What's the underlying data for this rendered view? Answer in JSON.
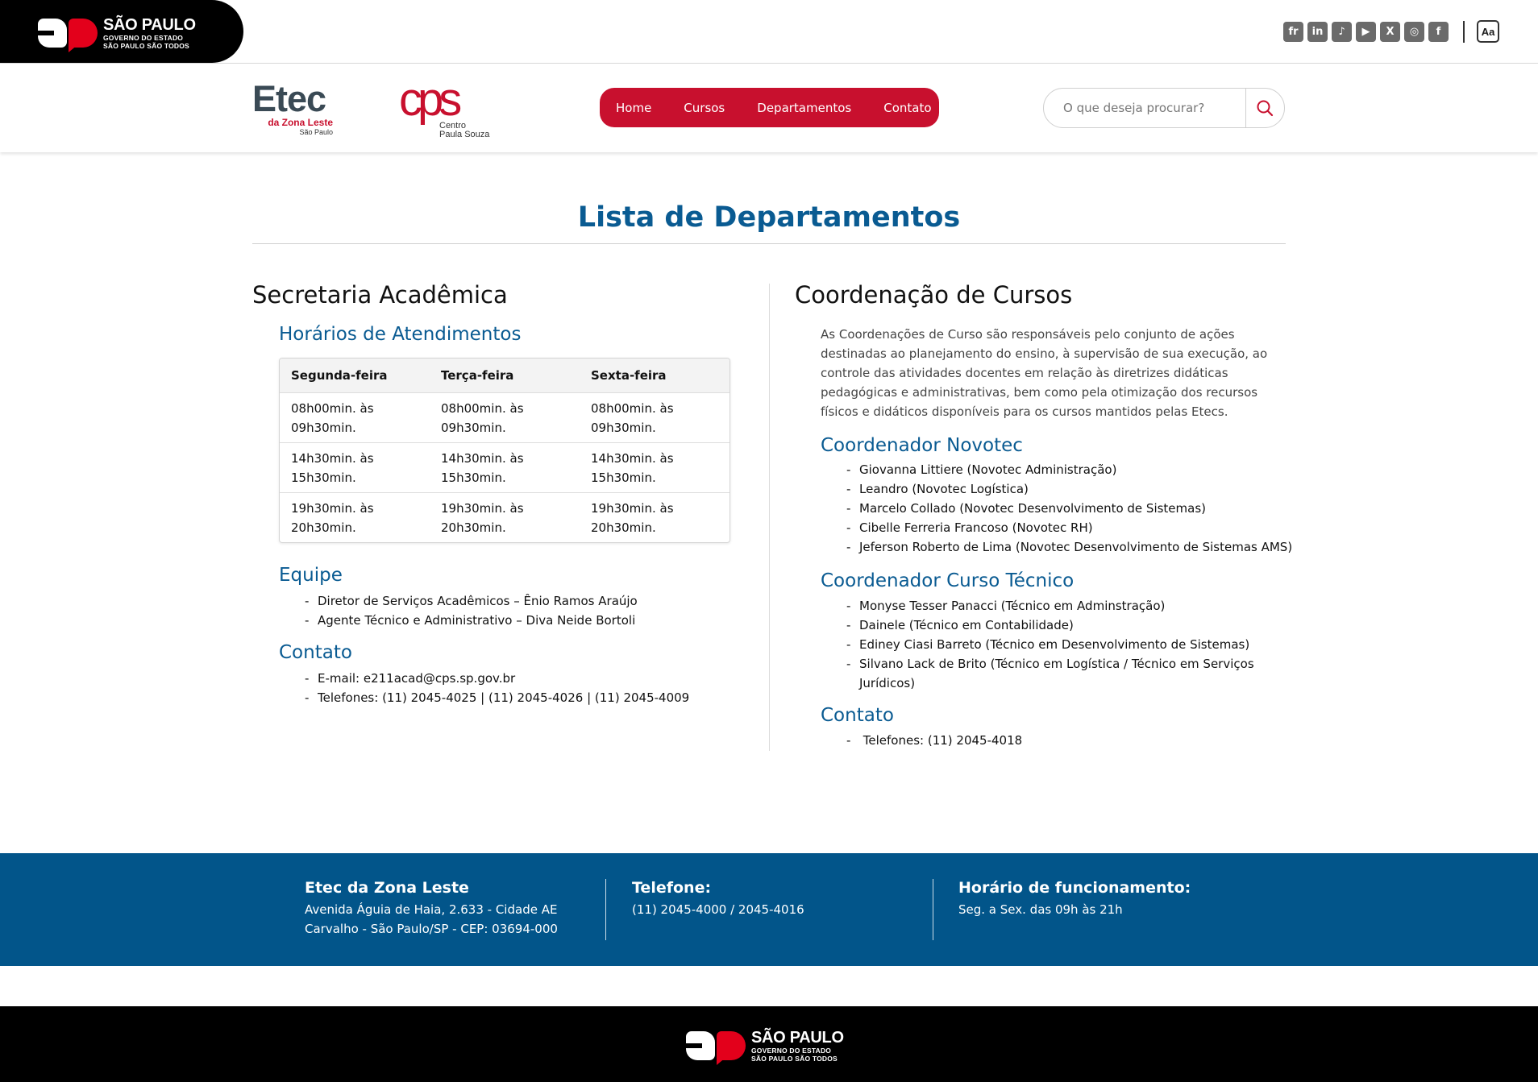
{
  "gov_bar": {
    "logo": {
      "line1": "SÃO PAULO",
      "line2": "GOVERNO DO ESTADO",
      "line3": "SÃO PAULO SÃO TODOS"
    },
    "social_icons": [
      {
        "icon": "flickr-icon",
        "glyph": "fr"
      },
      {
        "icon": "linkedin-icon",
        "glyph": "in"
      },
      {
        "icon": "tiktok-icon",
        "glyph": "♪"
      },
      {
        "icon": "youtube-icon",
        "glyph": "▶"
      },
      {
        "icon": "x-twitter-icon",
        "glyph": "X"
      },
      {
        "icon": "instagram-icon",
        "glyph": "◎"
      },
      {
        "icon": "facebook-icon",
        "glyph": "f"
      }
    ],
    "accessibility_label": "Aa"
  },
  "header": {
    "etec_logo": {
      "name": "Etec",
      "sub": "da Zona Leste",
      "city": "São Paulo"
    },
    "cps_logo": {
      "mark": "cps",
      "line1": "Centro",
      "line2": "Paula Souza"
    },
    "nav": [
      "Home",
      "Cursos",
      "Departamentos",
      "Contato"
    ],
    "search": {
      "placeholder": "O que deseja procurar?"
    }
  },
  "main": {
    "title": "Lista de Departamentos",
    "secretaria": {
      "heading": "Secretaria Acadêmica",
      "schedule_heading": "Horários de Atendimentos",
      "schedule": {
        "headers": [
          "Segunda-feira",
          "Terça-feira",
          "Sexta-feira"
        ],
        "rows": [
          [
            [
              "08h00min. às",
              "09h30min."
            ],
            [
              "08h00min. às",
              "09h30min."
            ],
            [
              "08h00min. às",
              "09h30min."
            ]
          ],
          [
            [
              "14h30min. às",
              "15h30min."
            ],
            [
              "14h30min. às",
              "15h30min."
            ],
            [
              "14h30min. às",
              "15h30min."
            ]
          ],
          [
            [
              "19h30min. às",
              "20h30min."
            ],
            [
              "19h30min. às",
              "20h30min."
            ],
            [
              "19h30min. às",
              "20h30min."
            ]
          ]
        ]
      },
      "team_heading": "Equipe",
      "team": [
        "Diretor de Serviços Acadêmicos – Ênio Ramos Araújo",
        "Agente Técnico e Administrativo – Diva Neide Bortoli"
      ],
      "contact_heading": "Contato",
      "contact": [
        "E-mail: e211acad@cps.sp.gov.br",
        "Telefones: (11) 2045-4025 | (11) 2045-4026 | (11) 2045-4009"
      ]
    },
    "coordenacao": {
      "heading": "Coordenação de Cursos",
      "description": "As Coordenações de Curso são responsáveis pelo conjunto de ações destinadas ao planejamento do ensino, à supervisão de sua execução, ao controle das atividades docentes em relação às diretrizes didáticas pedagógicas e administrativas, bem como pela otimização dos recursos físicos e didáticos disponíveis para os cursos mantidos pelas Etecs.",
      "novotec_heading": "Coordenador Novotec",
      "novotec": [
        "Giovanna Littiere (Novotec Administração)",
        "Leandro (Novotec Logística)",
        "Marcelo Collado (Novotec Desenvolvimento de Sistemas)",
        "Cibelle Ferreria Francoso (Novotec RH)",
        "Jeferson Roberto de Lima (Novotec Desenvolvimento de Sistemas AMS)"
      ],
      "tecnico_heading": "Coordenador Curso Técnico",
      "tecnico": [
        "Monyse Tesser Panacci (Técnico em Adminstração)",
        "Dainele (Técnico em Contabilidade)",
        "Ediney Ciasi Barreto (Técnico em Desenvolvimento de Sistemas)",
        "Silvano Lack de Brito (Técnico em Logística / Técnico em Serviços Jurídicos)"
      ],
      "contact_heading": "Contato",
      "contact": [
        " Telefones: (11) 2045-4018"
      ]
    }
  },
  "footer": {
    "address": {
      "title": "Etec da Zona Leste",
      "line1": "Avenida Águia de Haia, 2.633 - Cidade AE",
      "line2": "Carvalho - São Paulo/SP - CEP: 03694-000"
    },
    "phone": {
      "title": "Telefone:",
      "line1": "(11) 2045-4000 / 2045-4016"
    },
    "hours": {
      "title": "Horário de funcionamento:",
      "line1": "Seg. a Sex. das 09h às 21h"
    },
    "gov_logo": {
      "line1": "SÃO PAULO",
      "line2": "GOVERNO DO ESTADO",
      "line3": "SÃO PAULO SÃO TODOS"
    }
  },
  "colors": {
    "brand_red": "#c8102e",
    "brand_blue": "#0a5b92",
    "footer_blue": "#02558a"
  }
}
